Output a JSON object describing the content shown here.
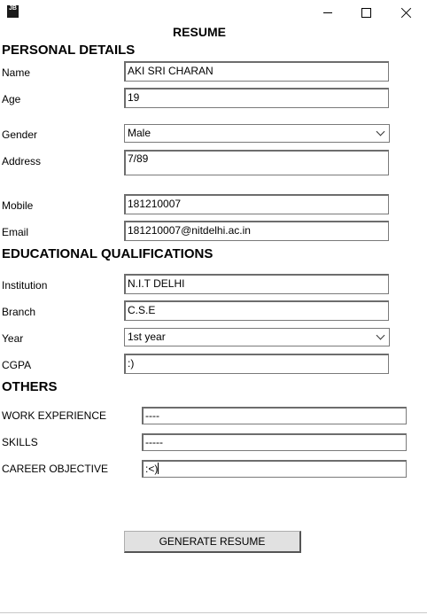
{
  "window": {
    "icon_text": "JB"
  },
  "form": {
    "title": "RESUME"
  },
  "personal": {
    "heading": "PERSONAL DETAILS",
    "name_label": "Name",
    "name_value": "AKI SRI CHARAN",
    "age_label": "Age",
    "age_value": "19",
    "gender_label": "Gender",
    "gender_value": "Male",
    "address_label": "Address",
    "address_value": "7/89",
    "mobile_label": "Mobile",
    "mobile_value": "181210007",
    "email_label": "Email",
    "email_value": "181210007@nitdelhi.ac.in"
  },
  "education": {
    "heading": "EDUCATIONAL QUALIFICATIONS",
    "institution_label": "Institution",
    "institution_value": "N.I.T DELHI",
    "branch_label": "Branch",
    "branch_value": "C.S.E",
    "year_label": "Year",
    "year_value": "1st year",
    "cgpa_label": "CGPA",
    "cgpa_value": ":)"
  },
  "others": {
    "heading": "OTHERS",
    "work_label": "WORK EXPERIENCE",
    "work_value": "----",
    "skills_label": "SKILLS",
    "skills_value": "-----",
    "career_label": "CAREER OBJECTIVE",
    "career_value": ":<)"
  },
  "actions": {
    "generate_label": "GENERATE RESUME"
  }
}
